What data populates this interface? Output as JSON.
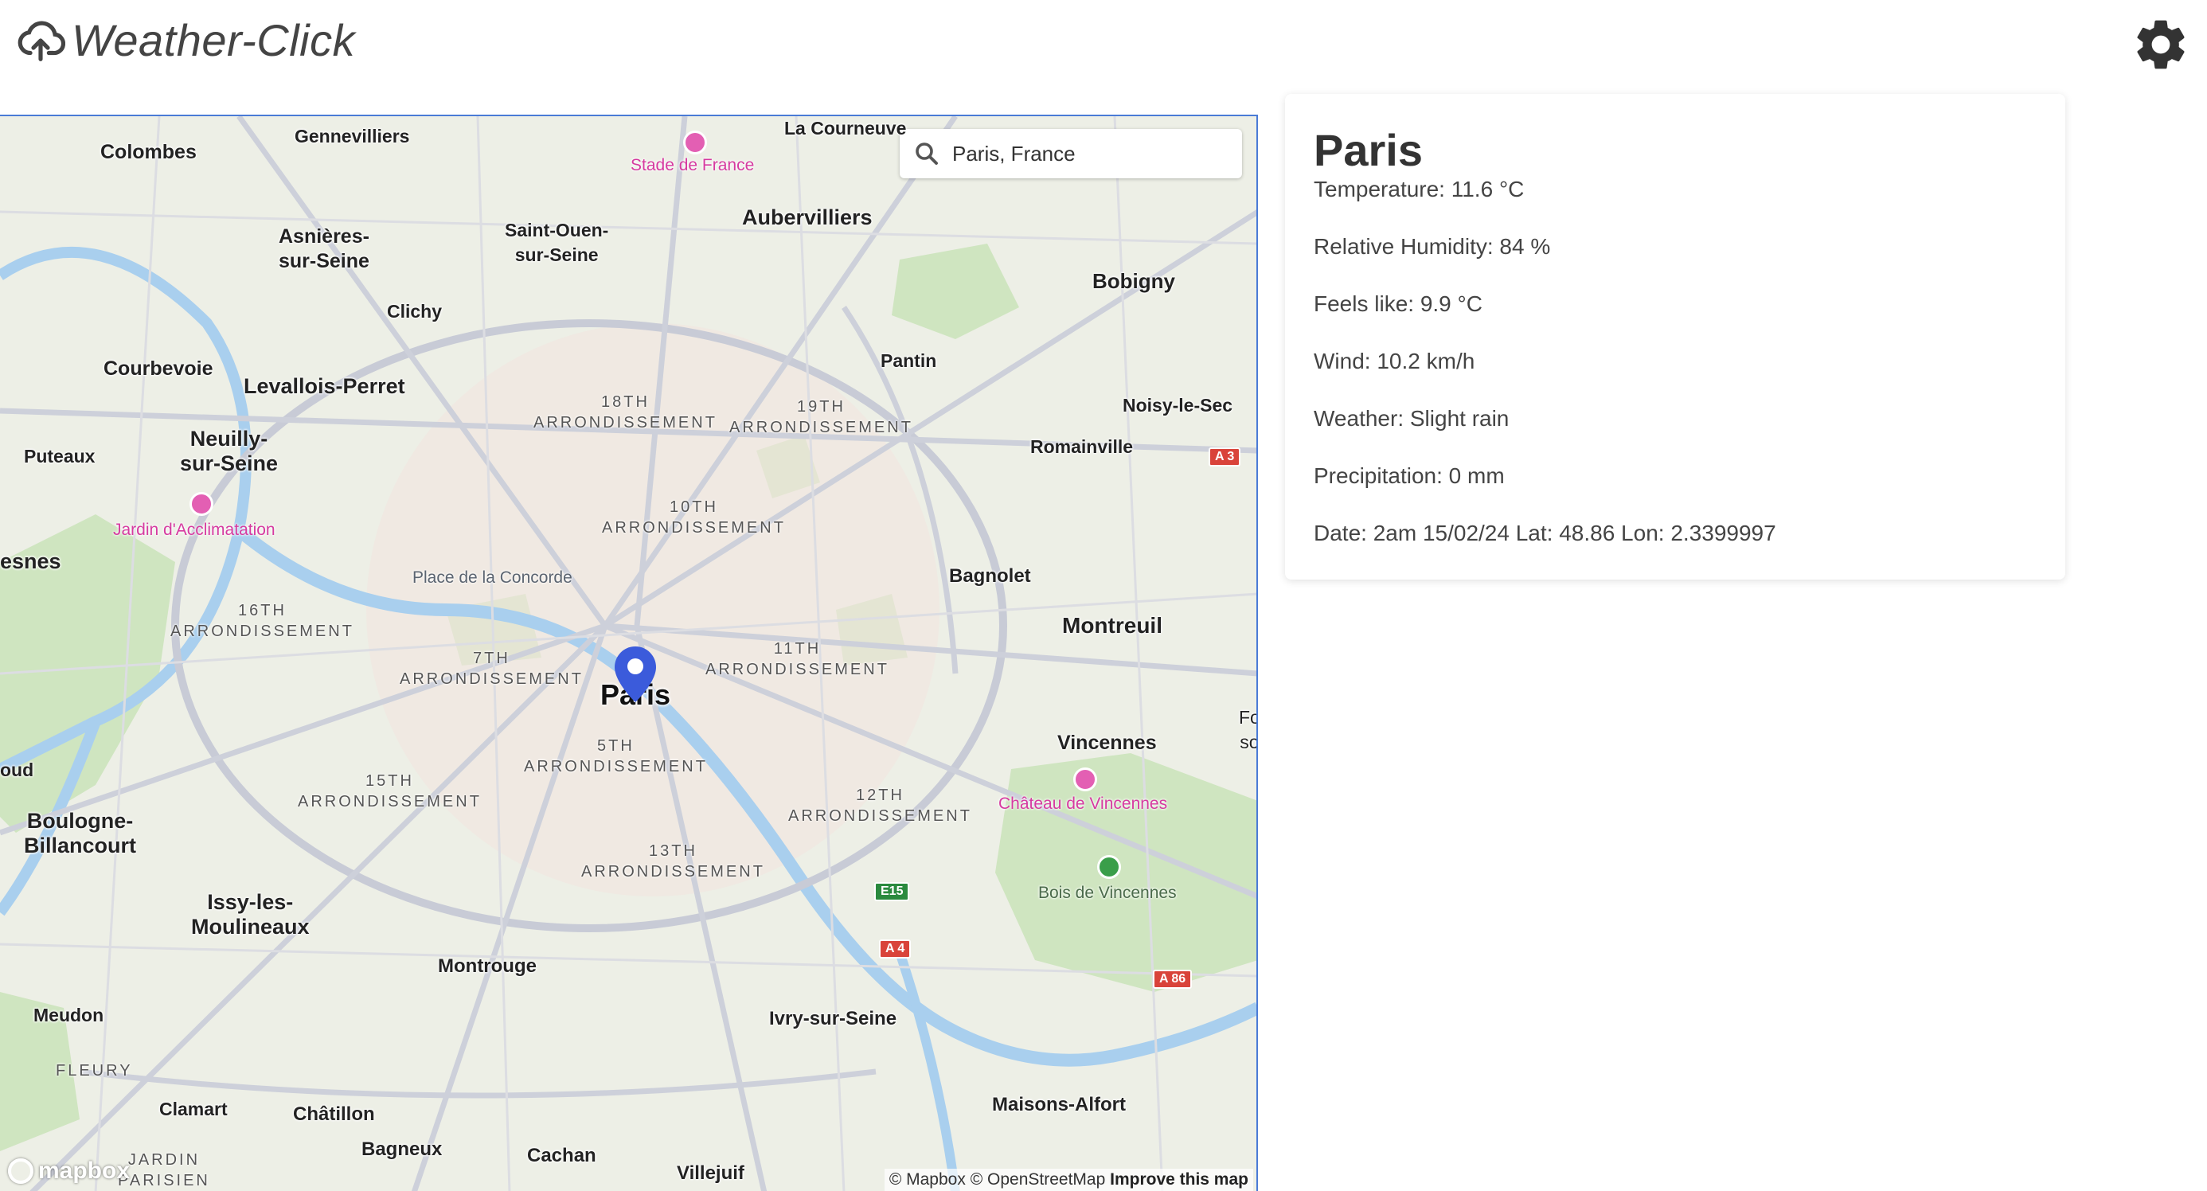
{
  "header": {
    "app_title": "Weather-Click",
    "logo_icon": "cloud-upload-icon",
    "settings_icon": "gear-icon"
  },
  "search": {
    "value": "Paris, France",
    "icon": "search-icon"
  },
  "map": {
    "labels": {
      "colombes": "Colombes",
      "gennevilliers": "Gennevilliers",
      "stade": "Stade de France",
      "lacourneuve": "La Courneuve",
      "asnieres": "Asnières-\nsur-Seine",
      "saintouen": "Saint-Ouen-\nsur-Seine",
      "aubervilliers": "Aubervilliers",
      "clichy": "Clichy",
      "bobigny": "Bobigny",
      "courbevoie": "Courbevoie",
      "levallois": "Levallois-Perret",
      "pantin": "Pantin",
      "neuilly": "Neuilly-\nsur-Seine",
      "puteaux": "Puteaux",
      "noisy": "Noisy-le-Sec",
      "romainville": "Romainville",
      "jardin": "Jardin d'Acclimatation",
      "esnes": "esnes",
      "bagnolet": "Bagnolet",
      "concorde": "Place de la Concorde",
      "montreuil": "Montreuil",
      "paris": "Paris",
      "vincennes": "Vincennes",
      "fo": "Fo\nso",
      "oud": "oud",
      "chateau": "Château de Vincennes",
      "boulogne": "Boulogne-\nBillancourt",
      "bois": "Bois de Vincennes",
      "issy": "Issy-les-\nMoulineaux",
      "montrouge": "Montrouge",
      "ivry": "Ivry-sur-Seine",
      "meudon": "Meudon",
      "fleury": "FLEURY",
      "clamart": "Clamart",
      "chatillon": "Châtillon",
      "maisons": "Maisons-Alfort",
      "jardinparisien": "JARDIN\nPARISIEN",
      "bagneux": "Bagneux",
      "cachan": "Cachan",
      "villejuif": "Villejuif"
    },
    "arrondissements": {
      "a18": "18TH\nARRONDISSEMENT",
      "a19": "19TH\nARRONDISSEMENT",
      "a10": "10TH\nARRONDISSEMENT",
      "a16": "16TH\nARRONDISSEMENT",
      "a7": "7TH\nARRONDISSEMENT",
      "a11": "11TH\nARRONDISSEMENT",
      "a5": "5TH\nARRONDISSEMENT",
      "a15": "15TH\nARRONDISSEMENT",
      "a12": "12TH\nARRONDISSEMENT",
      "a13": "13TH\nARRONDISSEMENT"
    },
    "roads": {
      "a3": "A 3",
      "e15": "E15",
      "a4": "A 4",
      "a86": "A 86"
    },
    "attribution": {
      "mapbox": "© Mapbox",
      "osm": "© OpenStreetMap",
      "improve": "Improve this map"
    },
    "mapbox_logo": "mapbox"
  },
  "weather": {
    "city": "Paris",
    "temperature": "Temperature: 11.6 °C",
    "humidity": "Relative Humidity: 84 %",
    "feels_like": "Feels like: 9.9 °C",
    "wind": "Wind: 10.2 km/h",
    "condition": "Weather: Slight rain",
    "precipitation": "Precipitation: 0 mm",
    "date_coords": "Date: 2am 15/02/24 Lat: 48.86 Lon: 2.3399997"
  },
  "colors": {
    "map_border": "#4a7bd6",
    "marker": "#3b5bdb",
    "poi_pink": "#d63aa0",
    "road_shield": "#d9433a"
  }
}
